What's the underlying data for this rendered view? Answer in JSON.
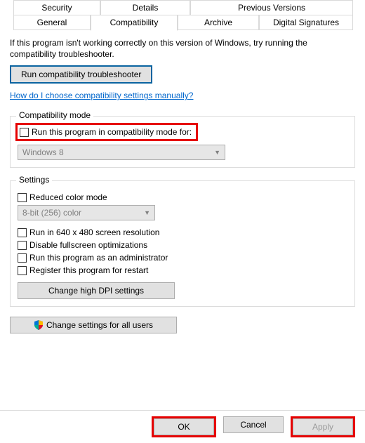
{
  "tabs": {
    "security": "Security",
    "details": "Details",
    "previous_versions": "Previous Versions",
    "general": "General",
    "compatibility": "Compatibility",
    "archive": "Archive",
    "digital_signatures": "Digital Signatures"
  },
  "intro": "If this program isn't working correctly on this version of Windows, try running the compatibility troubleshooter.",
  "buttons": {
    "troubleshoot": "Run compatibility troubleshooter",
    "dpi": "Change high DPI settings",
    "all_users": "Change settings for all users",
    "ok": "OK",
    "cancel": "Cancel",
    "apply": "Apply"
  },
  "link_manual": "How do I choose compatibility settings manually?",
  "group_compat": {
    "label": "Compatibility mode",
    "check": "Run this program in compatibility mode for:",
    "combo_value": "Windows 8"
  },
  "group_settings": {
    "label": "Settings",
    "reduced_color": "Reduced color mode",
    "color_combo": "8-bit (256) color",
    "run_640": "Run in 640 x 480 screen resolution",
    "disable_fs": "Disable fullscreen optimizations",
    "run_admin": "Run this program as an administrator",
    "register_restart": "Register this program for restart"
  }
}
